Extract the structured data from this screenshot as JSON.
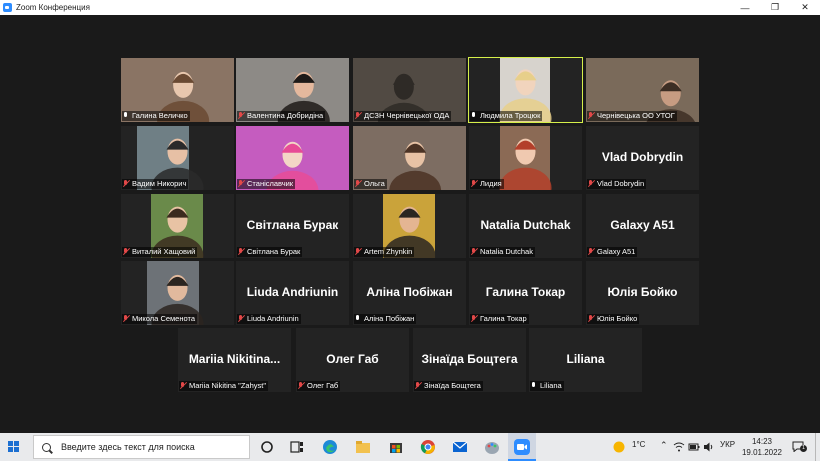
{
  "window": {
    "title": "Zoom Конференция",
    "controls": {
      "minimize": "—",
      "restore": "❐",
      "close": "✕"
    }
  },
  "participants": [
    {
      "name": "Галина Величко",
      "muted": false,
      "video": true,
      "active": false,
      "bg": "#8a7464"
    },
    {
      "name": "Валентина Добридіна",
      "muted": true,
      "video": true,
      "active": false,
      "bg": "#8d8a86"
    },
    {
      "name": "ДСЗН Чернівецької ОДА",
      "muted": true,
      "video": true,
      "active": false,
      "bg": "#514a43"
    },
    {
      "name": "Людмила Троцюк",
      "muted": false,
      "video": true,
      "active": true,
      "bg": "#d7d3cd"
    },
    {
      "name": "Чернівецька ОО УТОГ",
      "muted": true,
      "video": true,
      "active": false,
      "bg": "#7a6a5a"
    },
    {
      "name": "Вадим Никорич",
      "muted": true,
      "video": true,
      "active": false,
      "bg": "#6f7f85"
    },
    {
      "name": "Станіславчик",
      "muted": true,
      "video": true,
      "active": false,
      "bg": "#c55cbf"
    },
    {
      "name": "Ольга",
      "muted": true,
      "video": true,
      "active": false,
      "bg": "#7d6d62"
    },
    {
      "name": "Лидия",
      "muted": true,
      "video": true,
      "active": false,
      "bg": "#8b6a55"
    },
    {
      "name": "Vlad Dobrydin",
      "muted": true,
      "video": false,
      "active": false,
      "bg": "#232323"
    },
    {
      "name": "Виталий Хащовий",
      "muted": true,
      "video": true,
      "active": false,
      "bg": "#6a8a4a"
    },
    {
      "name": "Світлана Бурак",
      "muted": true,
      "video": false,
      "active": false,
      "bg": "#232323"
    },
    {
      "name": "Artem Zhynkin",
      "muted": true,
      "video": true,
      "active": false,
      "bg": "#caa33a"
    },
    {
      "name": "Natalia Dutchak",
      "muted": true,
      "video": false,
      "active": false,
      "bg": "#232323"
    },
    {
      "name": "Galaxy A51",
      "muted": true,
      "video": false,
      "active": false,
      "bg": "#232323"
    },
    {
      "name": "Микола Семенота",
      "muted": true,
      "video": true,
      "active": false,
      "bg": "#6d7277"
    },
    {
      "name": "Liuda Andriunin",
      "muted": true,
      "video": false,
      "active": false,
      "bg": "#232323"
    },
    {
      "name": "Аліна Побіжан",
      "muted": false,
      "video": false,
      "active": false,
      "bg": "#232323"
    },
    {
      "name": "Галина Токар",
      "muted": true,
      "video": false,
      "active": false,
      "bg": "#232323"
    },
    {
      "name": "Юлія Бойко",
      "muted": true,
      "video": false,
      "active": false,
      "bg": "#232323"
    },
    {
      "name": "Mariia Nikitina \"Zahyst\"",
      "short": "Mariia Nikitina...",
      "muted": true,
      "video": false,
      "active": false,
      "bg": "#232323"
    },
    {
      "name": "Олег Габ",
      "muted": true,
      "video": false,
      "active": false,
      "bg": "#232323"
    },
    {
      "name": "Зінаїда Бощтега",
      "muted": true,
      "video": false,
      "active": false,
      "bg": "#232323"
    },
    {
      "name": "Liliana",
      "muted": false,
      "video": false,
      "active": false,
      "bg": "#232323"
    }
  ],
  "taskbar": {
    "search_placeholder": "Введите здесь текст для поиска",
    "icons": [
      "cortana-icon",
      "task-view-icon",
      "edge-icon",
      "file-explorer-icon",
      "store-icon",
      "chrome-icon",
      "mail-icon",
      "paint-icon",
      "zoom-icon"
    ],
    "weather": "1°C",
    "language": "УКР",
    "time": "14:23",
    "date": "19.01.2022",
    "notifications": "1"
  },
  "colors": {
    "active_speaker": "#d6f04a",
    "muted_mic": "#e24848",
    "zoom_blue": "#2d8cff"
  }
}
